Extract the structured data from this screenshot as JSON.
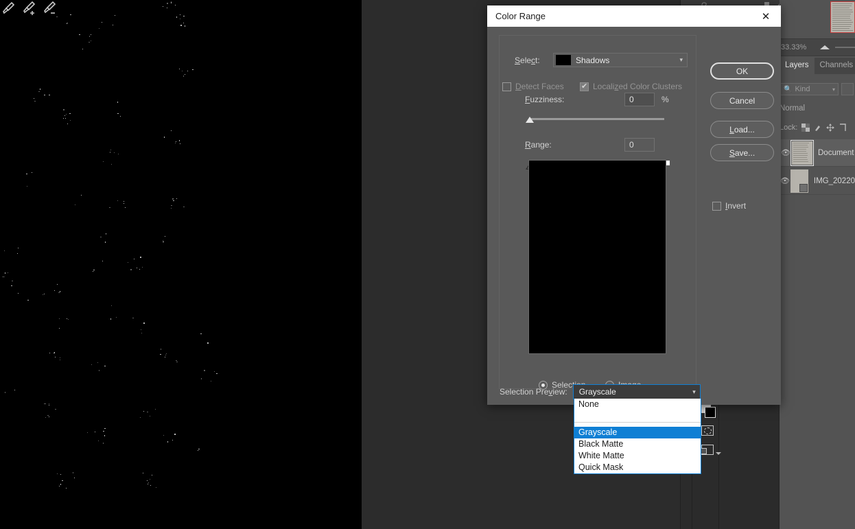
{
  "workspace": {
    "zoom_level": "33.33%",
    "panel_tabs": [
      {
        "label": "Layers",
        "active": true
      },
      {
        "label": "Channels",
        "active": false
      }
    ],
    "filter_kind_label": "Kind",
    "blend_mode": "Normal",
    "lock_label": "Lock:",
    "layers": [
      {
        "name": "Document",
        "selected": true
      },
      {
        "name": "IMG_20220",
        "selected": false
      }
    ]
  },
  "dialog": {
    "title": "Color Range",
    "close_icon": "✕",
    "select_label": "Select:",
    "select_value": "Shadows",
    "detect_faces_label": "Detect Faces",
    "detect_faces_checked": false,
    "localized_clusters_label": "Localized Color Clusters",
    "localized_clusters_checked": true,
    "fuzziness_label": "Fuzziness:",
    "fuzziness_value": "0",
    "fuzziness_unit": "%",
    "range_label": "Range:",
    "range_value": "0",
    "preview_mode_selection": "Selection",
    "preview_mode_image": "Image",
    "preview_mode_active": "Selection",
    "buttons": {
      "ok": "OK",
      "cancel": "Cancel",
      "load": "Load...",
      "save": "Save..."
    },
    "eyedroppers": [
      "eyedropper-icon",
      "eyedropper-add-icon",
      "eyedropper-subtract-icon"
    ],
    "invert_label": "Invert",
    "invert_checked": false,
    "selection_preview_label": "Selection Preview:",
    "selection_preview_value": "Grayscale",
    "selection_preview_options": [
      "None",
      "Grayscale",
      "Black Matte",
      "White Matte",
      "Quick Mask"
    ],
    "selection_preview_highlighted": "Grayscale"
  },
  "colors": {
    "dialog_bg": "#595959",
    "titlebar_bg": "#ffffff",
    "accent_blue": "#0f7fd4",
    "panel_bg": "#535353",
    "workspace_bg": "#2b2b2b",
    "canvas_bg": "#000000"
  }
}
